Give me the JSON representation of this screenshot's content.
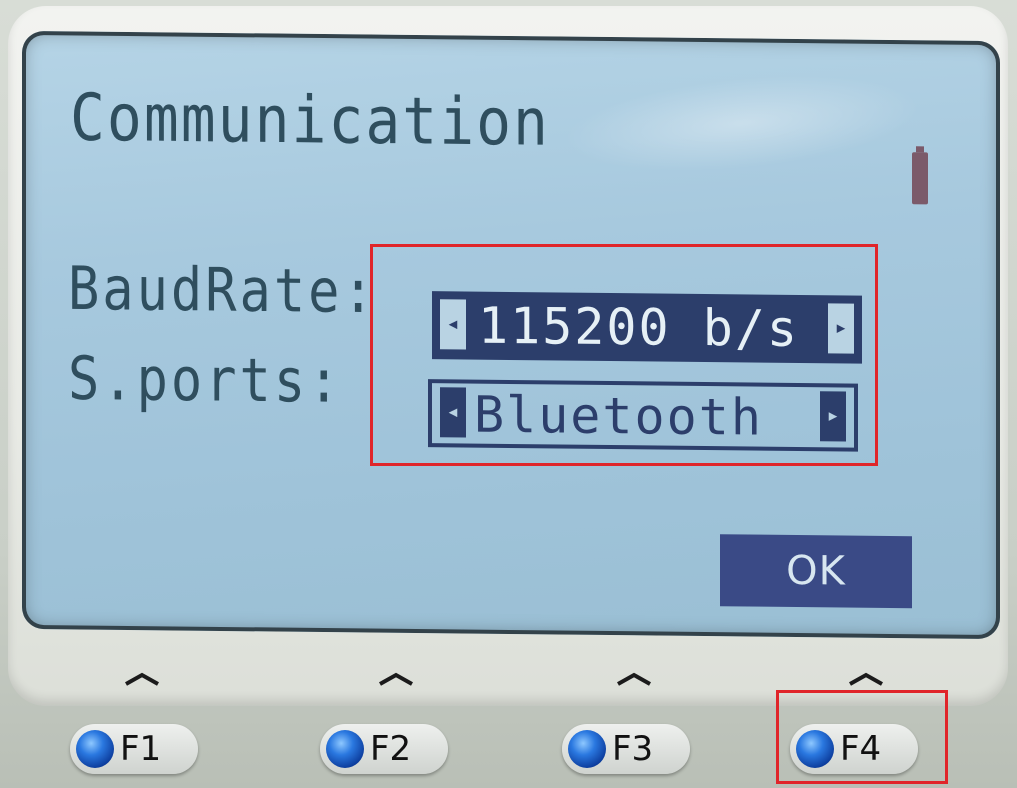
{
  "screen": {
    "title": "Communication",
    "battery_icon": "battery-icon"
  },
  "settings": {
    "baud_rate": {
      "label": "BaudRate:",
      "value": "115200 b/s",
      "selected": true
    },
    "serial_ports": {
      "label": "S.ports:",
      "value": "Bluetooth",
      "selected": false
    }
  },
  "arrows": {
    "left": "◂",
    "right": "▸"
  },
  "ok_button": {
    "label": "OK"
  },
  "function_keys": [
    {
      "label": "F1"
    },
    {
      "label": "F2"
    },
    {
      "label": "F3"
    },
    {
      "label": "F4"
    }
  ],
  "colors": {
    "lcd_background": "#a7c9de",
    "lcd_text": "#2f4e5e",
    "selection": "#2c3e6b",
    "annotation": "#e0252a",
    "key_led": "#2a78e0"
  }
}
